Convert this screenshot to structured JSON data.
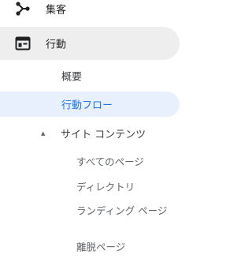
{
  "sections": [
    {
      "label": "集客",
      "icon": "acquisition-icon"
    },
    {
      "label": "行動",
      "icon": "behavior-icon"
    }
  ],
  "behavior_items": {
    "overview": "概要",
    "behavior_flow": "行動フロー",
    "site_content": {
      "label": "サイト コンテンツ",
      "caret": "▲",
      "children": [
        "すべてのページ",
        "ディレクトリ",
        "ランディング ページ",
        "離脱ページ"
      ]
    }
  },
  "colors": {
    "active_text": "#1a73e8",
    "active_bg": "#e8f0fe",
    "selected_section_bg": "#eeeeee"
  }
}
